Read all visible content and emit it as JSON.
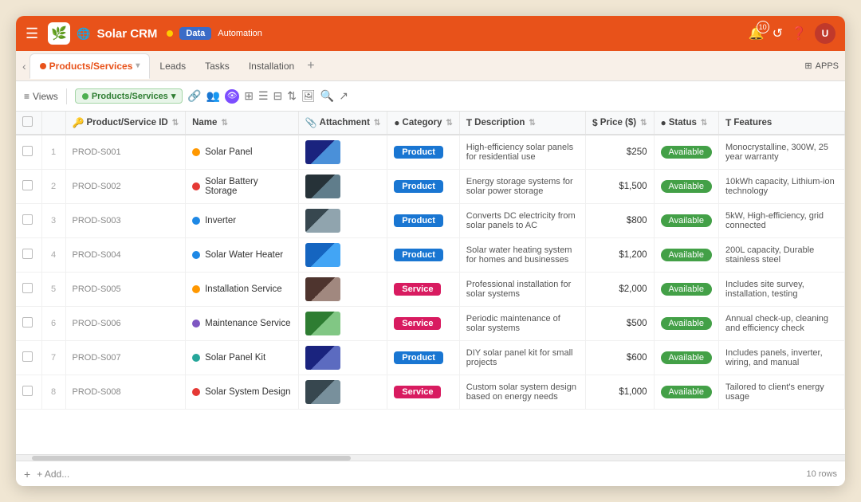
{
  "app": {
    "logo": "🌿",
    "title": "Solar CRM",
    "nav_dot_color": "#ffcc00",
    "data_label": "Data",
    "automation_label": "Automation",
    "avatar_initials": "U"
  },
  "tabs": [
    {
      "id": "products",
      "label": "Products/Services",
      "active": true
    },
    {
      "id": "leads",
      "label": "Leads",
      "active": false
    },
    {
      "id": "tasks",
      "label": "Tasks",
      "active": false
    },
    {
      "id": "installation",
      "label": "Installation",
      "active": false
    }
  ],
  "toolbar": {
    "views_label": "Views",
    "db_label": "Products/Services",
    "apps_label": "APPS"
  },
  "table": {
    "columns": [
      {
        "id": "checkbox",
        "label": ""
      },
      {
        "id": "rownum",
        "label": ""
      },
      {
        "id": "id",
        "label": "Product/Service ID"
      },
      {
        "id": "name",
        "label": "Name"
      },
      {
        "id": "attachment",
        "label": "Attachment"
      },
      {
        "id": "category",
        "label": "Category"
      },
      {
        "id": "description",
        "label": "Description"
      },
      {
        "id": "price",
        "label": "Price ($)"
      },
      {
        "id": "status",
        "label": "Status"
      },
      {
        "id": "features",
        "label": "Features"
      }
    ],
    "rows": [
      {
        "num": "1",
        "id": "PROD-S001",
        "name": "Solar Panel",
        "dot_color": "#ff9800",
        "thumb_class": "thumb-solar",
        "category": "Product",
        "cat_class": "cat-product",
        "description": "High-efficiency solar panels for residential use",
        "price": "$250",
        "status": "Available",
        "features": "Monocrystalline, 300W, 25 year warranty"
      },
      {
        "num": "2",
        "id": "PROD-S002",
        "name": "Solar Battery Storage",
        "dot_color": "#e53935",
        "thumb_class": "thumb-battery",
        "category": "Product",
        "cat_class": "cat-product",
        "description": "Energy storage systems for solar power storage",
        "price": "$1,500",
        "status": "Available",
        "features": "10kWh capacity, Lithium-ion technology"
      },
      {
        "num": "3",
        "id": "PROD-S003",
        "name": "Inverter",
        "dot_color": "#1e88e5",
        "thumb_class": "thumb-inverter",
        "category": "Product",
        "cat_class": "cat-product",
        "description": "Converts DC electricity from solar panels to AC",
        "price": "$800",
        "status": "Available",
        "features": "5kW, High-efficiency, grid connected"
      },
      {
        "num": "4",
        "id": "PROD-S004",
        "name": "Solar Water Heater",
        "dot_color": "#1e88e5",
        "thumb_class": "thumb-water",
        "category": "Product",
        "cat_class": "cat-product",
        "description": "Solar water heating system for homes and businesses",
        "price": "$1,200",
        "status": "Available",
        "features": "200L capacity, Durable stainless steel"
      },
      {
        "num": "5",
        "id": "PROD-S005",
        "name": "Installation Service",
        "dot_color": "#ff9800",
        "thumb_class": "thumb-install",
        "category": "Service",
        "cat_class": "cat-service",
        "description": "Professional installation for solar systems",
        "price": "$2,000",
        "status": "Available",
        "features": "Includes site survey, installation, testing"
      },
      {
        "num": "6",
        "id": "PROD-S006",
        "name": "Maintenance Service",
        "dot_color": "#7e57c2",
        "thumb_class": "thumb-maint",
        "category": "Service",
        "cat_class": "cat-service",
        "description": "Periodic maintenance of solar systems",
        "price": "$500",
        "status": "Available",
        "features": "Annual check-up, cleaning and efficiency check"
      },
      {
        "num": "7",
        "id": "PROD-S007",
        "name": "Solar Panel Kit",
        "dot_color": "#26a69a",
        "thumb_class": "thumb-kit",
        "category": "Product",
        "cat_class": "cat-product",
        "description": "DIY solar panel kit for small projects",
        "price": "$600",
        "status": "Available",
        "features": "Includes panels, inverter, wiring, and manual"
      },
      {
        "num": "8",
        "id": "PROD-S008",
        "name": "Solar System Design",
        "dot_color": "#e53935",
        "thumb_class": "thumb-design",
        "category": "Service",
        "cat_class": "cat-service",
        "description": "Custom solar system design based on energy needs",
        "price": "$1,000",
        "status": "Available",
        "features": "Tailored to client's energy usage"
      }
    ],
    "footer": {
      "add_label": "+ Add...",
      "row_count": "10 rows"
    }
  }
}
